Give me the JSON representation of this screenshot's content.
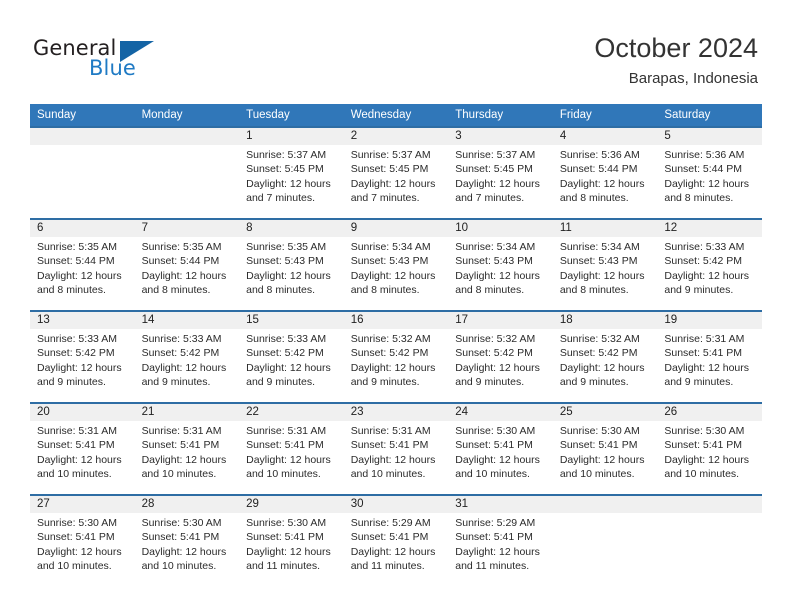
{
  "logo": {
    "word_top": "General",
    "word_bottom": "Blue",
    "triangle_color": "#1464a5",
    "blue_color": "#1f7ac4"
  },
  "header": {
    "title": "October 2024",
    "subtitle": "Barapas, Indonesia"
  },
  "colors": {
    "header_blue": "#3077b9",
    "row_divider_blue": "#2e6da4",
    "daynum_band": "#f0f0f0",
    "text": "#222222"
  },
  "weekdays": [
    "Sunday",
    "Monday",
    "Tuesday",
    "Wednesday",
    "Thursday",
    "Friday",
    "Saturday"
  ],
  "weeks": [
    [
      {
        "day": "",
        "sunrise": "",
        "sunset": "",
        "daylight": ""
      },
      {
        "day": "",
        "sunrise": "",
        "sunset": "",
        "daylight": ""
      },
      {
        "day": "1",
        "sunrise": "Sunrise: 5:37 AM",
        "sunset": "Sunset: 5:45 PM",
        "daylight": "Daylight: 12 hours and 7 minutes."
      },
      {
        "day": "2",
        "sunrise": "Sunrise: 5:37 AM",
        "sunset": "Sunset: 5:45 PM",
        "daylight": "Daylight: 12 hours and 7 minutes."
      },
      {
        "day": "3",
        "sunrise": "Sunrise: 5:37 AM",
        "sunset": "Sunset: 5:45 PM",
        "daylight": "Daylight: 12 hours and 7 minutes."
      },
      {
        "day": "4",
        "sunrise": "Sunrise: 5:36 AM",
        "sunset": "Sunset: 5:44 PM",
        "daylight": "Daylight: 12 hours and 8 minutes."
      },
      {
        "day": "5",
        "sunrise": "Sunrise: 5:36 AM",
        "sunset": "Sunset: 5:44 PM",
        "daylight": "Daylight: 12 hours and 8 minutes."
      }
    ],
    [
      {
        "day": "6",
        "sunrise": "Sunrise: 5:35 AM",
        "sunset": "Sunset: 5:44 PM",
        "daylight": "Daylight: 12 hours and 8 minutes."
      },
      {
        "day": "7",
        "sunrise": "Sunrise: 5:35 AM",
        "sunset": "Sunset: 5:44 PM",
        "daylight": "Daylight: 12 hours and 8 minutes."
      },
      {
        "day": "8",
        "sunrise": "Sunrise: 5:35 AM",
        "sunset": "Sunset: 5:43 PM",
        "daylight": "Daylight: 12 hours and 8 minutes."
      },
      {
        "day": "9",
        "sunrise": "Sunrise: 5:34 AM",
        "sunset": "Sunset: 5:43 PM",
        "daylight": "Daylight: 12 hours and 8 minutes."
      },
      {
        "day": "10",
        "sunrise": "Sunrise: 5:34 AM",
        "sunset": "Sunset: 5:43 PM",
        "daylight": "Daylight: 12 hours and 8 minutes."
      },
      {
        "day": "11",
        "sunrise": "Sunrise: 5:34 AM",
        "sunset": "Sunset: 5:43 PM",
        "daylight": "Daylight: 12 hours and 8 minutes."
      },
      {
        "day": "12",
        "sunrise": "Sunrise: 5:33 AM",
        "sunset": "Sunset: 5:42 PM",
        "daylight": "Daylight: 12 hours and 9 minutes."
      }
    ],
    [
      {
        "day": "13",
        "sunrise": "Sunrise: 5:33 AM",
        "sunset": "Sunset: 5:42 PM",
        "daylight": "Daylight: 12 hours and 9 minutes."
      },
      {
        "day": "14",
        "sunrise": "Sunrise: 5:33 AM",
        "sunset": "Sunset: 5:42 PM",
        "daylight": "Daylight: 12 hours and 9 minutes."
      },
      {
        "day": "15",
        "sunrise": "Sunrise: 5:33 AM",
        "sunset": "Sunset: 5:42 PM",
        "daylight": "Daylight: 12 hours and 9 minutes."
      },
      {
        "day": "16",
        "sunrise": "Sunrise: 5:32 AM",
        "sunset": "Sunset: 5:42 PM",
        "daylight": "Daylight: 12 hours and 9 minutes."
      },
      {
        "day": "17",
        "sunrise": "Sunrise: 5:32 AM",
        "sunset": "Sunset: 5:42 PM",
        "daylight": "Daylight: 12 hours and 9 minutes."
      },
      {
        "day": "18",
        "sunrise": "Sunrise: 5:32 AM",
        "sunset": "Sunset: 5:42 PM",
        "daylight": "Daylight: 12 hours and 9 minutes."
      },
      {
        "day": "19",
        "sunrise": "Sunrise: 5:31 AM",
        "sunset": "Sunset: 5:41 PM",
        "daylight": "Daylight: 12 hours and 9 minutes."
      }
    ],
    [
      {
        "day": "20",
        "sunrise": "Sunrise: 5:31 AM",
        "sunset": "Sunset: 5:41 PM",
        "daylight": "Daylight: 12 hours and 10 minutes."
      },
      {
        "day": "21",
        "sunrise": "Sunrise: 5:31 AM",
        "sunset": "Sunset: 5:41 PM",
        "daylight": "Daylight: 12 hours and 10 minutes."
      },
      {
        "day": "22",
        "sunrise": "Sunrise: 5:31 AM",
        "sunset": "Sunset: 5:41 PM",
        "daylight": "Daylight: 12 hours and 10 minutes."
      },
      {
        "day": "23",
        "sunrise": "Sunrise: 5:31 AM",
        "sunset": "Sunset: 5:41 PM",
        "daylight": "Daylight: 12 hours and 10 minutes."
      },
      {
        "day": "24",
        "sunrise": "Sunrise: 5:30 AM",
        "sunset": "Sunset: 5:41 PM",
        "daylight": "Daylight: 12 hours and 10 minutes."
      },
      {
        "day": "25",
        "sunrise": "Sunrise: 5:30 AM",
        "sunset": "Sunset: 5:41 PM",
        "daylight": "Daylight: 12 hours and 10 minutes."
      },
      {
        "day": "26",
        "sunrise": "Sunrise: 5:30 AM",
        "sunset": "Sunset: 5:41 PM",
        "daylight": "Daylight: 12 hours and 10 minutes."
      }
    ],
    [
      {
        "day": "27",
        "sunrise": "Sunrise: 5:30 AM",
        "sunset": "Sunset: 5:41 PM",
        "daylight": "Daylight: 12 hours and 10 minutes."
      },
      {
        "day": "28",
        "sunrise": "Sunrise: 5:30 AM",
        "sunset": "Sunset: 5:41 PM",
        "daylight": "Daylight: 12 hours and 10 minutes."
      },
      {
        "day": "29",
        "sunrise": "Sunrise: 5:30 AM",
        "sunset": "Sunset: 5:41 PM",
        "daylight": "Daylight: 12 hours and 11 minutes."
      },
      {
        "day": "30",
        "sunrise": "Sunrise: 5:29 AM",
        "sunset": "Sunset: 5:41 PM",
        "daylight": "Daylight: 12 hours and 11 minutes."
      },
      {
        "day": "31",
        "sunrise": "Sunrise: 5:29 AM",
        "sunset": "Sunset: 5:41 PM",
        "daylight": "Daylight: 12 hours and 11 minutes."
      },
      {
        "day": "",
        "sunrise": "",
        "sunset": "",
        "daylight": ""
      },
      {
        "day": "",
        "sunrise": "",
        "sunset": "",
        "daylight": ""
      }
    ]
  ]
}
